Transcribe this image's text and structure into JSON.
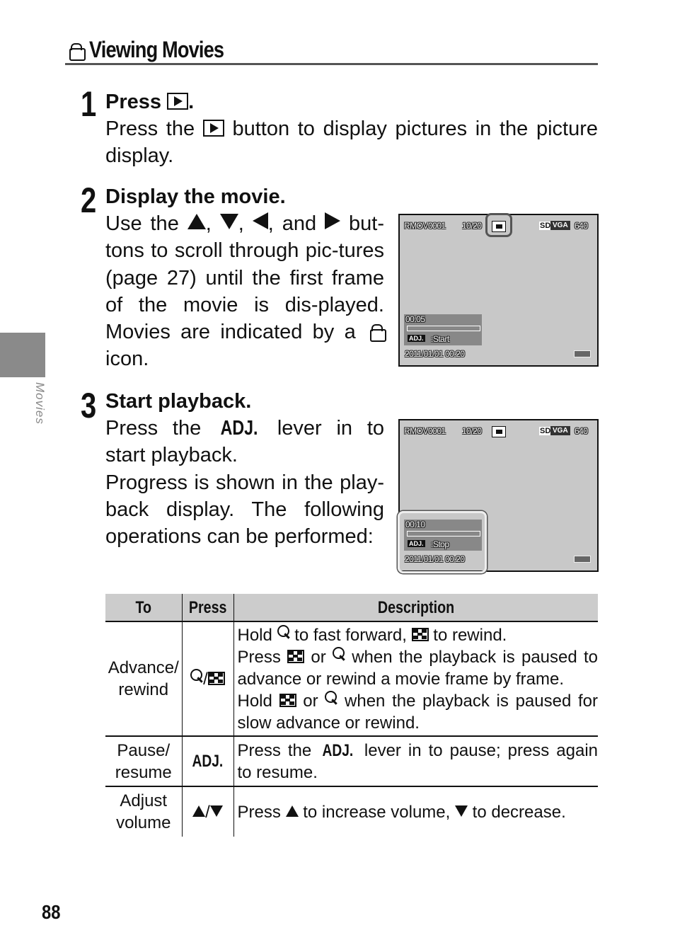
{
  "title": "Viewing Movies",
  "title_icon": "movie-icon",
  "side_tab": "Movies",
  "page_number": "88",
  "steps": [
    {
      "num": "1",
      "heading_pre": "Press",
      "heading_post": ".",
      "body_pre": "Press the",
      "body_post": "button to display pictures in the picture display."
    },
    {
      "num": "2",
      "heading": "Display the movie.",
      "b1": "Use the",
      ",": ",",
      "b_and": ", and",
      "b2": "but-tons to scroll through pic-tures (page 27) until the first frame of the movie is dis-played. Movies are indicated by a",
      "b3": "icon."
    },
    {
      "num": "3",
      "heading": "Start playback.",
      "p1_pre": "Press the",
      "adj": "ADJ.",
      "p1_post": "lever in to start playback.",
      "p2": "Progress is shown in the play-back display. The following operations can be performed:"
    }
  ],
  "screens": [
    {
      "file": "RMOV0001",
      "count": "10/20",
      "sd": "SD",
      "vga": "VGA",
      "res": "640",
      "time": "00:05",
      "adj": "ADJ.",
      "action": ":Start",
      "date": "2011/01/01 00:20",
      "progress": 0
    },
    {
      "file": "RMOV0001",
      "count": "10/20",
      "sd": "SD",
      "vga": "VGA",
      "res": "640",
      "time": "00:10",
      "adj": "ADJ.",
      "action": ":Stop",
      "date": "2011/01/01 00:20",
      "progress": 0
    }
  ],
  "table": {
    "headers": [
      "To",
      "Press",
      "Description"
    ],
    "rows": [
      {
        "to": "Advance/ rewind",
        "press_sep": "/",
        "d1": "Hold",
        "d2": "to fast forward,",
        "d3": "to rewind.",
        "d4": "Press",
        "d5": "or",
        "d6": "when the playback is paused to advance or rewind a movie frame by frame.",
        "d7": "Hold",
        "d8": "or",
        "d9": "when the playback is paused for slow advance or rewind."
      },
      {
        "to": "Pause/ resume",
        "press": "ADJ.",
        "d1": "Press the",
        "d2": "ADJ.",
        "d3": "lever in to pause; press again to resume."
      },
      {
        "to": "Adjust volume",
        "press_sep": "/",
        "d1": "Press",
        "d2": "to increase volume,",
        "d3": "to decrease."
      }
    ]
  }
}
